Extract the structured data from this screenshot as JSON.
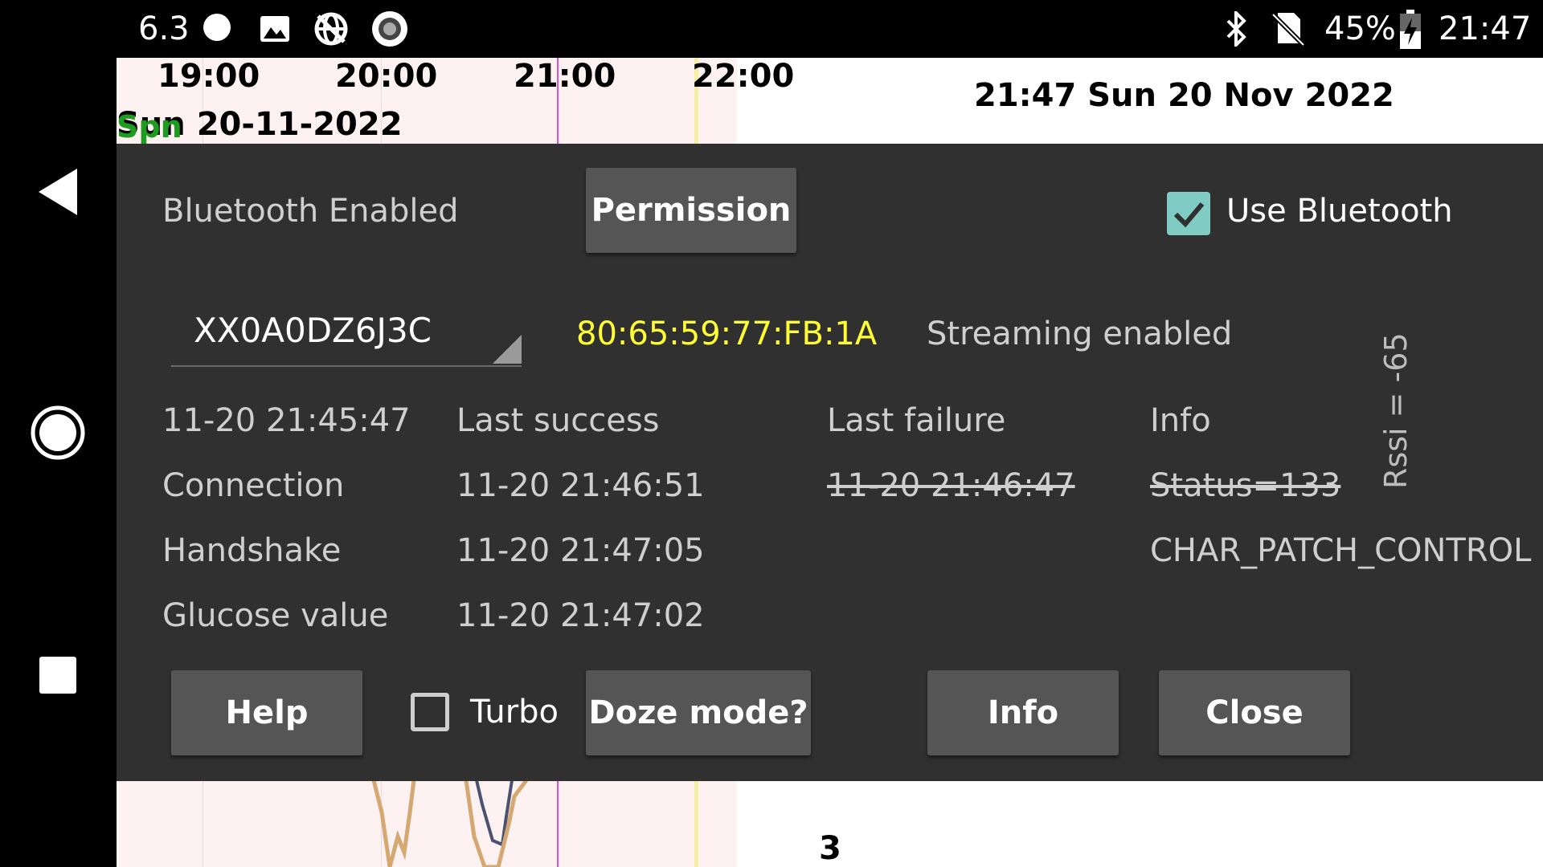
{
  "status_bar": {
    "left_indicator": "6.3",
    "battery_percent": "45%",
    "clock": "21:47",
    "icons": [
      "circle-icon",
      "image-icon",
      "globe-off-icon",
      "record-icon",
      "bluetooth-icon",
      "no-sim-icon",
      "battery-charging-icon"
    ]
  },
  "nav_bar": {
    "icons": [
      "back-icon",
      "home-icon",
      "recents-icon"
    ]
  },
  "graph": {
    "time_labels": [
      "19:00",
      "20:00",
      "21:00",
      "22:00"
    ],
    "date_label": "Sun 20-11-2022",
    "overlay_label": "Spn",
    "header_datetime": "21:47 Sun 20 Nov 2022",
    "bottom_value": "3",
    "colors": {
      "plot_bg": "#fdf1f1",
      "magenta_line": "#d15ad1",
      "yellow_line": "#f4f0a0",
      "tan_series": "#d4a870",
      "navy_series": "#4a5270"
    }
  },
  "dialog": {
    "bluetooth_status": "Bluetooth Enabled",
    "permission_button": "Permission",
    "use_bluetooth_label": "Use Bluetooth",
    "use_bluetooth_checked": true,
    "device_selector_value": "XX0A0DZ6J3C",
    "mac_address": "80:65:59:77:FB:1A",
    "streaming_status": "Streaming enabled",
    "rssi": "Rssi = -65",
    "table": {
      "corner": "11-20 21:45:47",
      "headers": [
        "Last success",
        "Last failure",
        "Info"
      ],
      "rows": [
        {
          "label": "Connection",
          "success": "11-20 21:46:51",
          "failure": "11-20 21:46:47",
          "info": "Status=133",
          "struck": true
        },
        {
          "label": "Handshake",
          "success": "11-20 21:47:05",
          "failure": "",
          "info": "CHAR_PATCH_CONTROL",
          "struck": false
        },
        {
          "label": "Glucose value",
          "success": "11-20 21:47:02",
          "failure": "",
          "info": "",
          "struck": false
        }
      ]
    },
    "buttons": {
      "help": "Help",
      "turbo": "Turbo",
      "turbo_checked": false,
      "doze": "Doze mode?",
      "info": "Info",
      "close": "Close"
    },
    "colors": {
      "background": "#303030",
      "button": "#555555",
      "accent_teal": "#80cbc4",
      "mac_yellow": "#ffff33"
    }
  }
}
